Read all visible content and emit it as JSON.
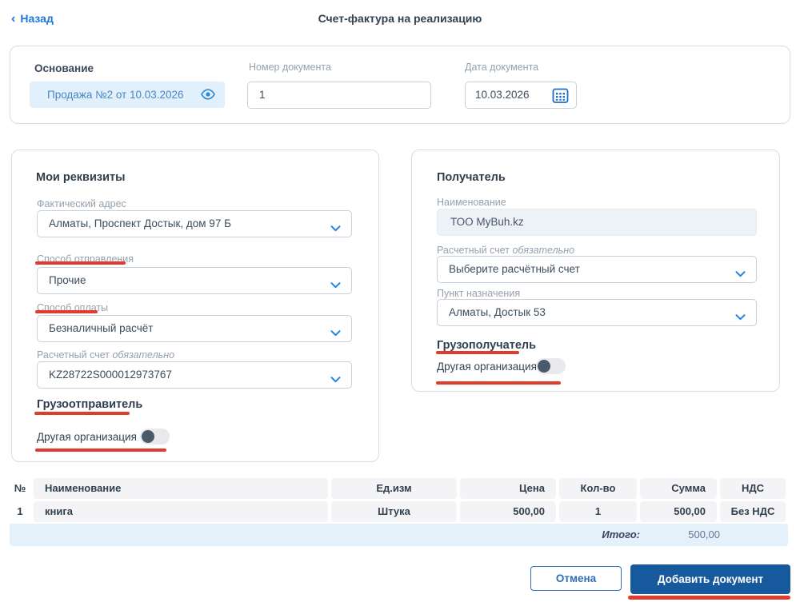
{
  "page": {
    "back_label": "Назад",
    "back_chevron": "‹",
    "title": "Счет-фактура на реализацию"
  },
  "top_panel": {
    "basis_label": "Основание",
    "basis_value": "Продажа №2 от 10.03.2026",
    "doc_number": {
      "label": "Номер документа",
      "value": "1"
    },
    "doc_date": {
      "label": "Дата документа",
      "value": "10.03.2026"
    }
  },
  "my_details": {
    "title": "Мои реквизиты",
    "actual_address": {
      "label": "Фактический адрес",
      "value": "Алматы, Проспект Достык, дом 97 Б"
    },
    "shipping_method": {
      "label": "Способ отправления",
      "value": "Прочие"
    },
    "payment_method": {
      "label": "Способ оплаты",
      "value": "Безналичный расчёт"
    },
    "bank_account": {
      "label": "Расчетный счет",
      "required": "обязательно",
      "value": "KZ28722S000012973767"
    },
    "consignor_title": "Грузоотправитель",
    "other_org_label": "Другая организация",
    "other_org_toggle_state": "off"
  },
  "recipient": {
    "title": "Получатель",
    "name": {
      "label": "Наименование",
      "value": "ТОО MyBuh.kz"
    },
    "bank_account": {
      "label": "Расчетный счет",
      "required": "обязательно",
      "placeholder": "Выберите расчётный счет"
    },
    "destination": {
      "label": "Пункт назначения",
      "value": "Алматы, Достык 53"
    },
    "consignee_title": "Грузополучатель",
    "other_org_label": "Другая организация",
    "other_org_toggle_state": "off"
  },
  "items_table": {
    "headers": [
      "№",
      "Наименование",
      "Ед.изм",
      "Цена",
      "Кол-во",
      "Сумма",
      "НДС"
    ],
    "rows": [
      [
        "1",
        "книга",
        "Штука",
        "500,00",
        "1",
        "500,00",
        "Без НДС"
      ]
    ],
    "total_label": "Итого:",
    "total_value": "500,00"
  },
  "actions": {
    "cancel_label": "Отмена",
    "submit_label": "Добавить документ"
  },
  "icons": [
    "back-chevron-icon",
    "eye-icon",
    "calendar-icon",
    "chevron-down-icon"
  ],
  "colors": {
    "accent_blue": "#1d78d7",
    "button_blue": "#17599d",
    "chip_bg": "#e1f0fb",
    "chip_text": "#4a87c6",
    "label_gray": "#94a1ad",
    "text_dark": "#33414f",
    "table_cell_bg": "#f4f4f6",
    "table_footer_bg": "#e4f1fb",
    "toggle_knob": "#4b5a6b",
    "annotation_red": "#e13b2c"
  }
}
